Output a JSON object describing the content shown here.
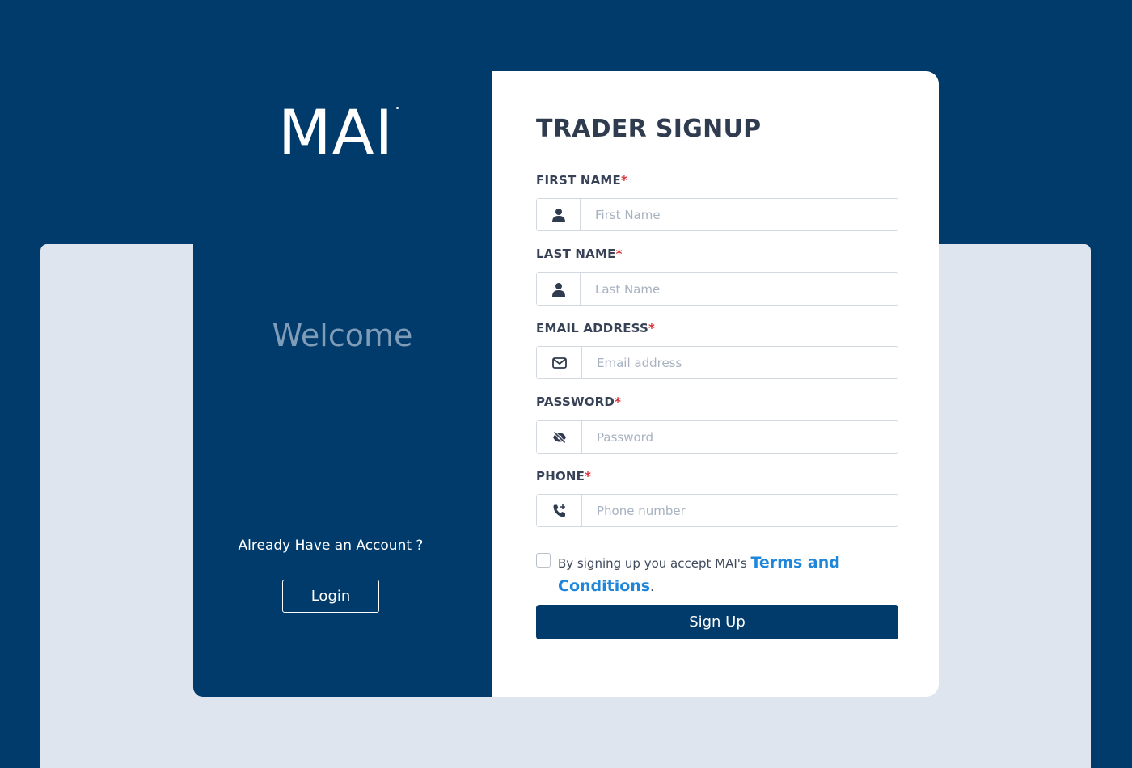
{
  "brand": {
    "logo_text": "MAI"
  },
  "left": {
    "welcome": "Welcome",
    "already_text": "Already Have an Account ?",
    "login_label": "Login"
  },
  "form": {
    "title": "TRADER SIGNUP",
    "required_mark": "*",
    "fields": [
      {
        "label": "FIRST NAME",
        "placeholder": "First Name",
        "icon": "user-icon"
      },
      {
        "label": "LAST NAME",
        "placeholder": "Last Name",
        "icon": "user-icon"
      },
      {
        "label": "EMAIL ADDRESS",
        "placeholder": "Email address",
        "icon": "envelope-icon"
      },
      {
        "label": "PASSWORD",
        "placeholder": "Password",
        "icon": "eye-slash-icon"
      },
      {
        "label": "PHONE",
        "placeholder": "Phone number",
        "icon": "phone-icon"
      }
    ],
    "terms_prefix": "By signing up you accept MAI's ",
    "terms_link": "Terms and Conditions",
    "terms_suffix": ".",
    "signup_label": "Sign Up"
  },
  "colors": {
    "primary": "#013b6b",
    "background_light": "#dfe5ef",
    "link": "#1f86d9",
    "required": "#d9262e"
  }
}
